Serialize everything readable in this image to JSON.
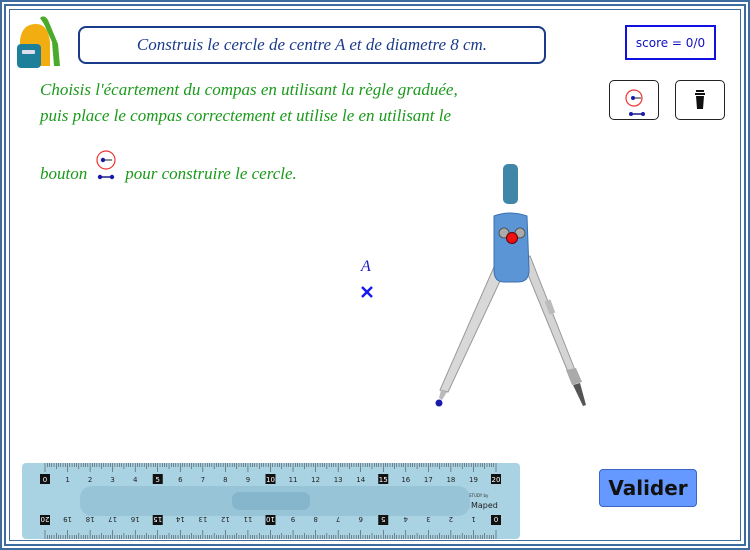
{
  "header": {
    "title": "Construis le cercle de centre A et de diametre 8 cm.",
    "score": "score = 0/0"
  },
  "instructions": {
    "line1": "Choisis l'écartement du compas en utilisant la règle graduée,",
    "line2": "puis place le compas correctement et utilise le en utilisant le",
    "line3_before": "bouton",
    "line3_after": "pour construire le cercle."
  },
  "toolbar": {
    "items": [
      {
        "icon": "circle-compass-tool-icon"
      },
      {
        "icon": "trash-icon"
      }
    ]
  },
  "canvas": {
    "point_label": "A"
  },
  "ruler": {
    "top_numbers": [
      "0",
      "1",
      "2",
      "3",
      "4",
      "5",
      "6",
      "7",
      "8",
      "9",
      "10",
      "11",
      "12",
      "13",
      "14",
      "15",
      "16",
      "17",
      "18",
      "19",
      "20"
    ],
    "brand_small": "STUDY by",
    "brand": "Maped"
  },
  "actions": {
    "validate": "Valider"
  },
  "colors": {
    "frame": "#3d6c9e",
    "title": "#1a3a8a",
    "instructions": "#1a9a1a",
    "validate": "#6699ff",
    "ruler": "#a9d3e3"
  }
}
